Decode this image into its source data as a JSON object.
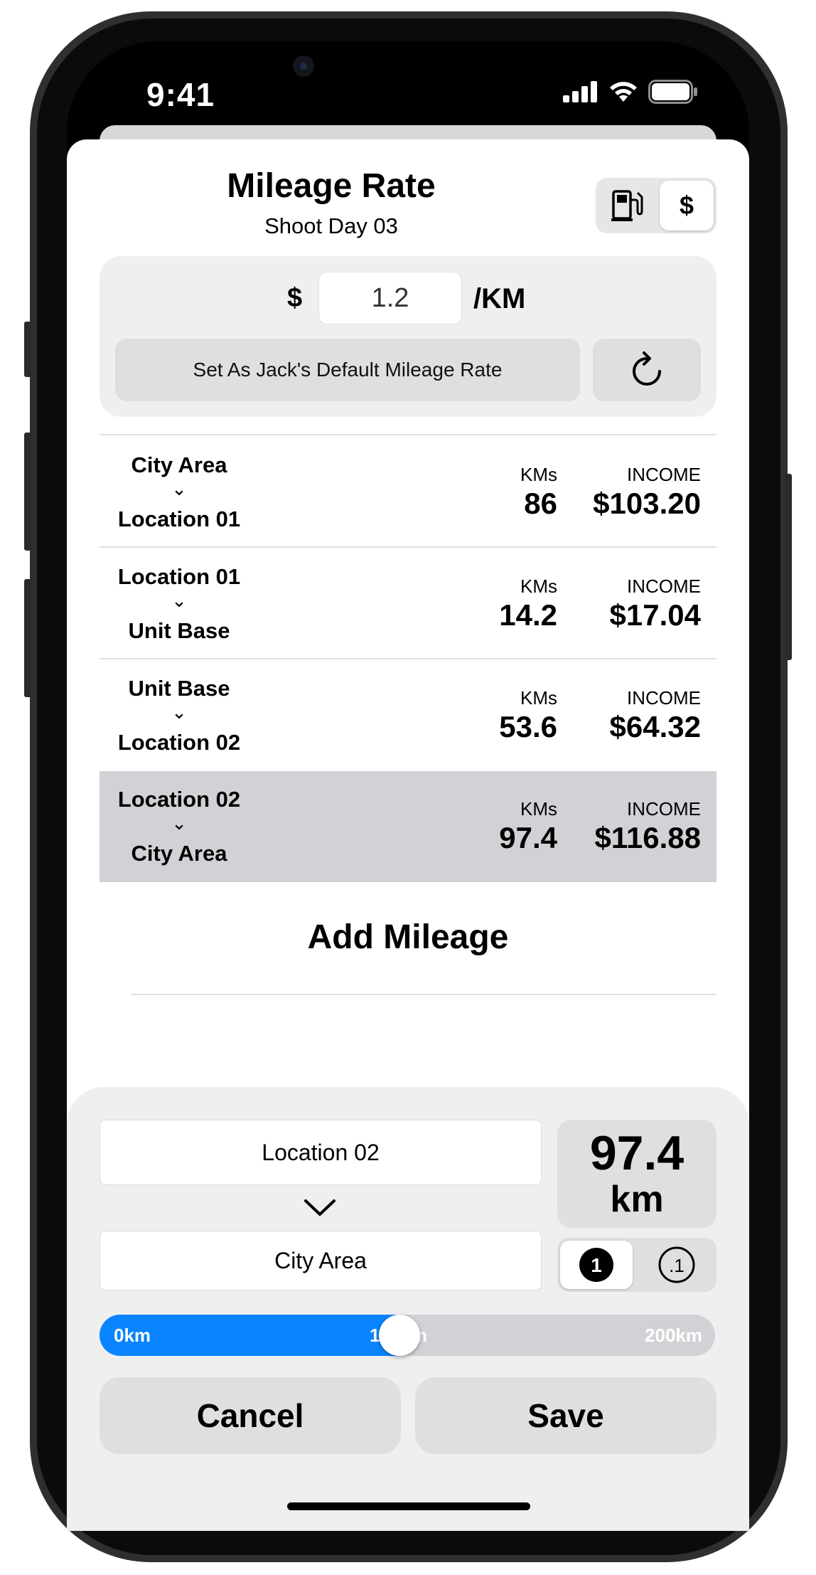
{
  "status_bar": {
    "time": "9:41"
  },
  "header": {
    "title": "Mileage Rate",
    "subtitle": "Shoot Day 03",
    "mode_segment": {
      "options": [
        "fuel-pump-icon",
        "$"
      ],
      "selected": "$"
    }
  },
  "rate": {
    "currency": "$",
    "value": "1.2",
    "unit": "/KM",
    "default_button": "Set As Jack's Default Mileage Rate"
  },
  "trips": [
    {
      "from": "City Area",
      "to": "Location 01",
      "kms_label": "KMs",
      "kms": "86",
      "income_label": "INCOME",
      "income": "$103.20",
      "selected": false
    },
    {
      "from": "Location 01",
      "to": "Unit Base",
      "kms_label": "KMs",
      "kms": "14.2",
      "income_label": "INCOME",
      "income": "$17.04",
      "selected": false
    },
    {
      "from": "Unit Base",
      "to": "Location 02",
      "kms_label": "KMs",
      "kms": "53.6",
      "income_label": "INCOME",
      "income": "$64.32",
      "selected": false
    },
    {
      "from": "Location 02",
      "to": "City Area",
      "kms_label": "KMs",
      "kms": "97.4",
      "income_label": "INCOME",
      "income": "$116.88",
      "selected": true
    }
  ],
  "add_mileage_label": "Add Mileage",
  "editor": {
    "from_value": "Location 02",
    "to_value": "City Area",
    "distance_value": "97.4",
    "distance_unit": "km",
    "precision_options": [
      "1",
      ".1"
    ],
    "precision_selected": "1",
    "slider": {
      "min_label": "0km",
      "mid_label": "100km",
      "max_label": "200km",
      "value_fraction": 0.487
    },
    "cancel_label": "Cancel",
    "save_label": "Save"
  },
  "colors": {
    "accent": "#0A84FF",
    "selected_row": "#D2D2D6",
    "panel": "#EFEFF0"
  }
}
